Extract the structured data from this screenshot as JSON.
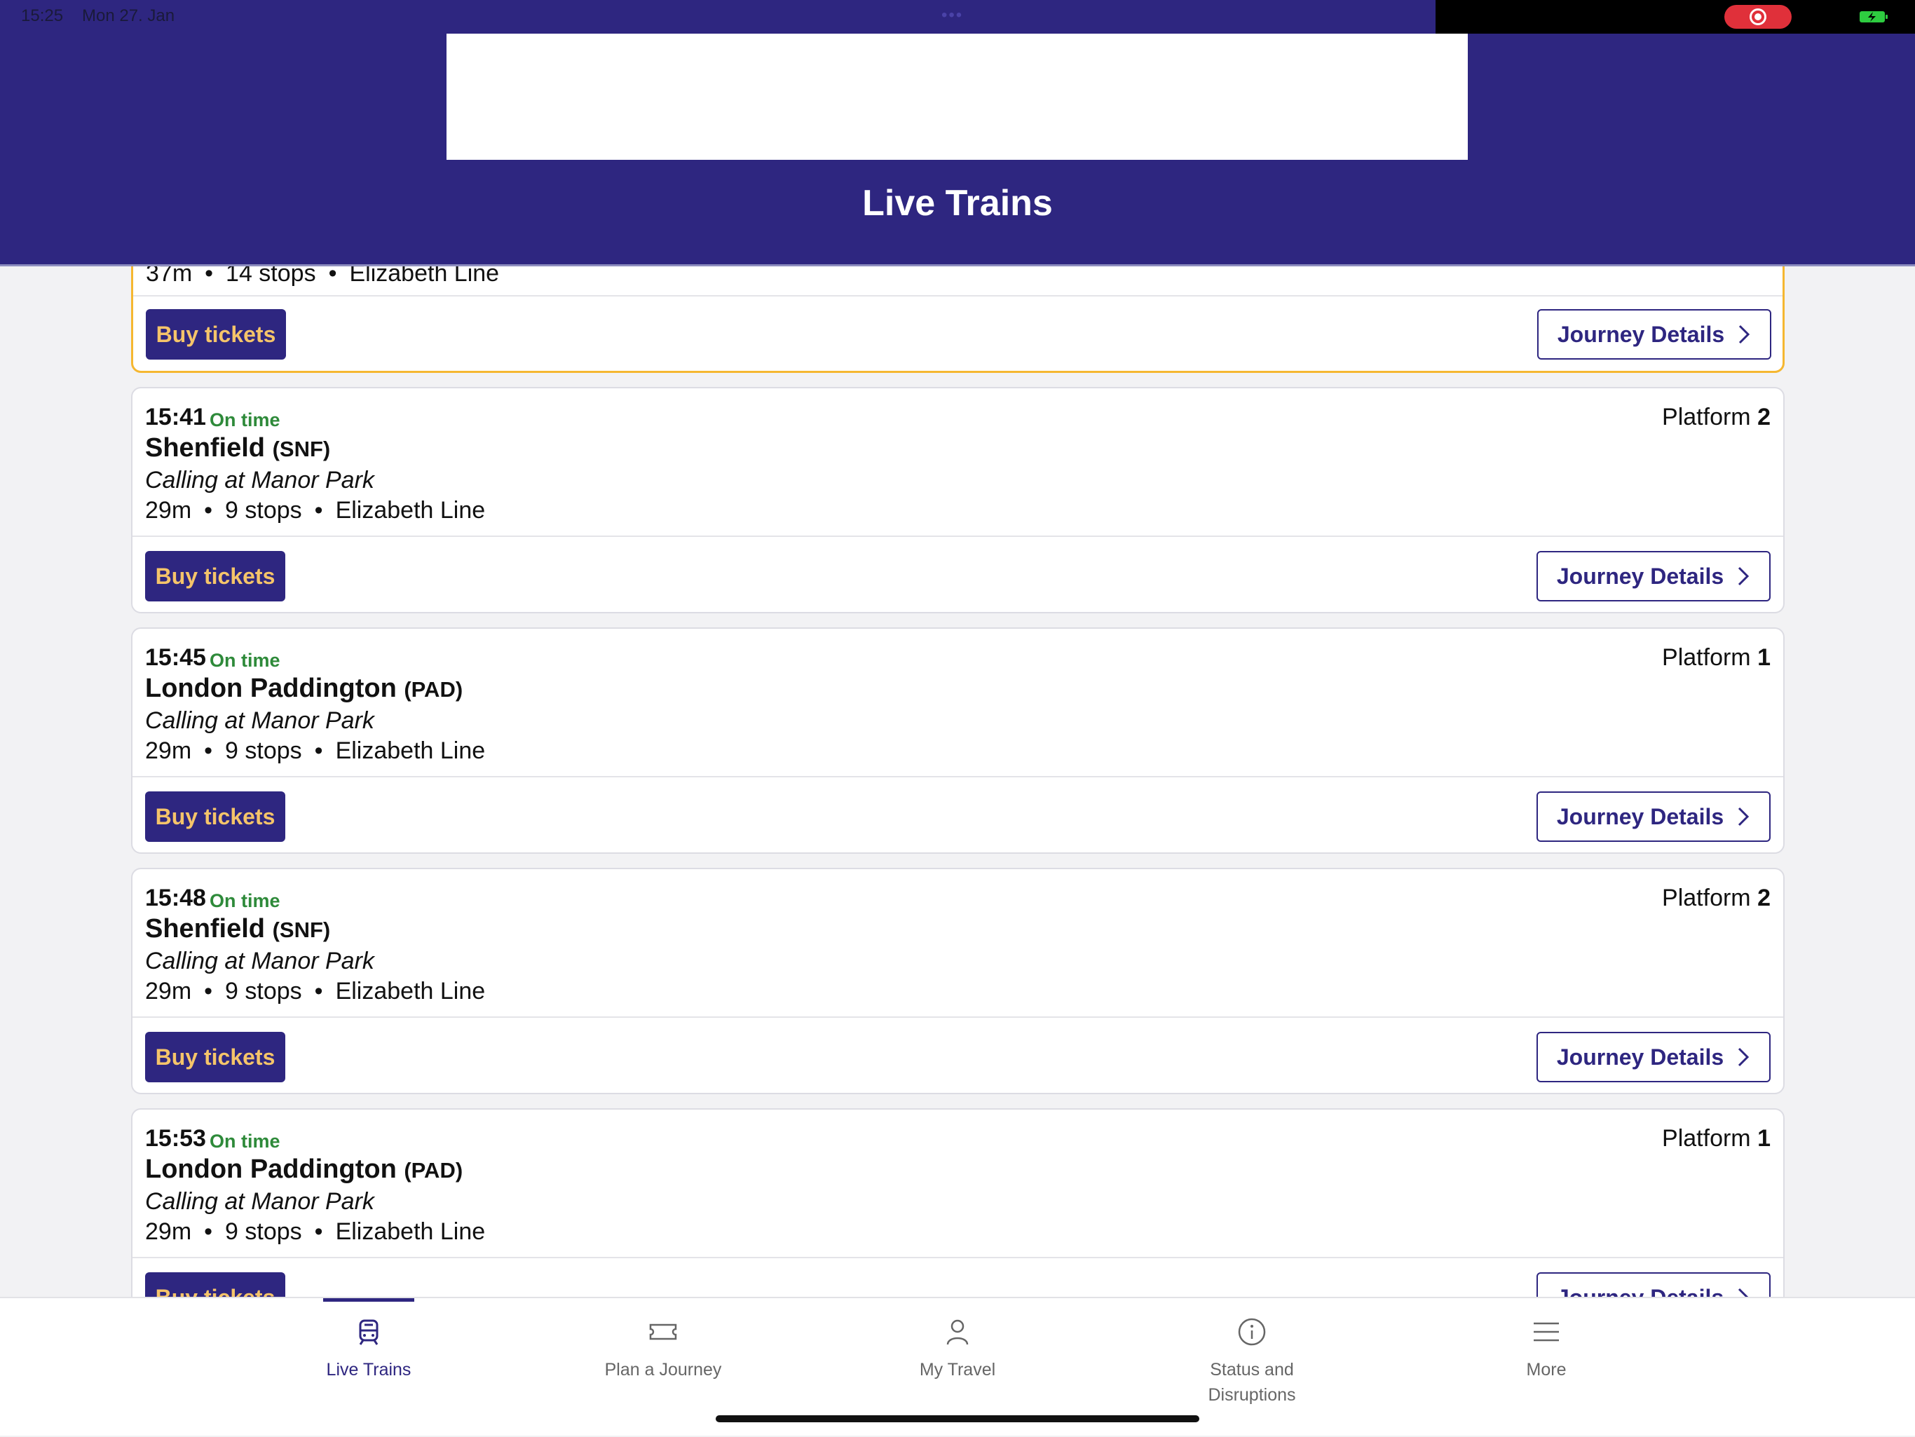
{
  "status_bar": {
    "time": "15:25",
    "date": "Mon 27. Jan",
    "dots": "•••"
  },
  "header": {
    "title": "Live Trains"
  },
  "partial_card": {
    "meta": [
      "37m",
      "14 stops",
      "Elizabeth Line"
    ],
    "buy_label": "Buy tickets",
    "details_label": "Journey Details"
  },
  "trains": [
    {
      "time": "15:41",
      "status": "On time",
      "platform_label": "Platform",
      "platform": "2",
      "destination": "Shenfield",
      "code": "(SNF)",
      "calling": "Calling at Manor Park",
      "duration": "29m",
      "stops": "9 stops",
      "line": "Elizabeth Line",
      "buy_label": "Buy tickets",
      "details_label": "Journey Details"
    },
    {
      "time": "15:45",
      "status": "On time",
      "platform_label": "Platform",
      "platform": "1",
      "destination": "London Paddington",
      "code": "(PAD)",
      "calling": "Calling at Manor Park",
      "duration": "29m",
      "stops": "9 stops",
      "line": "Elizabeth Line",
      "buy_label": "Buy tickets",
      "details_label": "Journey Details"
    },
    {
      "time": "15:48",
      "status": "On time",
      "platform_label": "Platform",
      "platform": "2",
      "destination": "Shenfield",
      "code": "(SNF)",
      "calling": "Calling at Manor Park",
      "duration": "29m",
      "stops": "9 stops",
      "line": "Elizabeth Line",
      "buy_label": "Buy tickets",
      "details_label": "Journey Details"
    },
    {
      "time": "15:53",
      "status": "On time",
      "platform_label": "Platform",
      "platform": "1",
      "destination": "London Paddington",
      "code": "(PAD)",
      "calling": "Calling at Manor Park",
      "duration": "29m",
      "stops": "9 stops",
      "line": "Elizabeth Line",
      "buy_label": "Buy tickets",
      "details_label": "Journey Details"
    }
  ],
  "tabs": [
    {
      "label": "Live Trains",
      "icon": "train-icon",
      "active": true
    },
    {
      "label": "Plan a Journey",
      "icon": "ticket-icon",
      "active": false
    },
    {
      "label": "My Travel",
      "icon": "person-icon",
      "active": false
    },
    {
      "label": "Status and Disruptions",
      "icon": "info-icon",
      "active": false
    },
    {
      "label": "More",
      "icon": "menu-icon",
      "active": false
    }
  ],
  "colors": {
    "brand": "#2e2680",
    "on_time": "#2e8a3a",
    "highlight_border": "#f5b731",
    "buy_text": "#f5c46a"
  }
}
